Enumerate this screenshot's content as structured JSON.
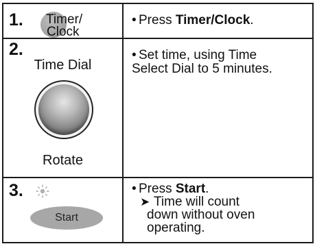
{
  "steps": [
    {
      "number": "1.",
      "button_label_line1": "Timer/",
      "button_label_line2": "Clock",
      "instruction_prefix": "Press ",
      "instruction_bold": "Timer/Clock",
      "instruction_suffix": "."
    },
    {
      "number": "2.",
      "dial_title": "Time Dial",
      "dial_caption": "Rotate",
      "instruction_line1": "Set time, using Time",
      "instruction_line2": "Select Dial to 5 minutes."
    },
    {
      "number": "3.",
      "button_label": "Start",
      "instruction_prefix": "Press ",
      "instruction_bold": "Start",
      "instruction_suffix": ".",
      "result_line1": "Time will count",
      "result_line2": "down without oven",
      "result_line3": "operating."
    }
  ],
  "icons": {
    "bullet": "•",
    "arrow": "➤",
    "indicator": "sun-icon"
  },
  "colors": {
    "border": "#1a1a1a",
    "button_gray": "#a7a7a7"
  }
}
